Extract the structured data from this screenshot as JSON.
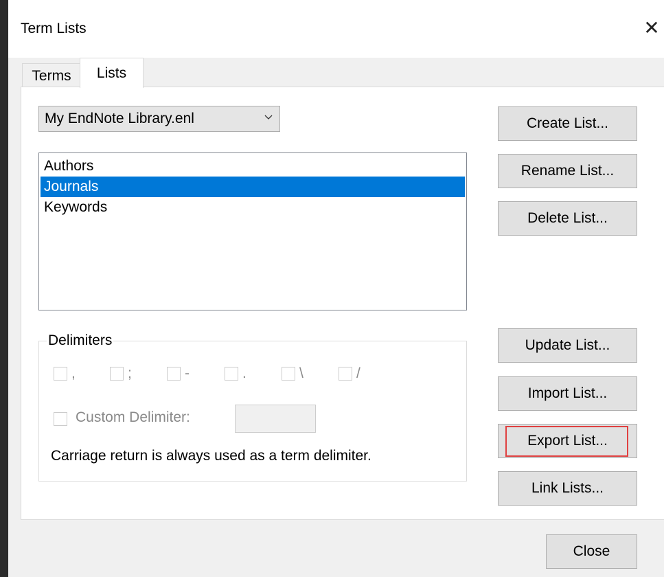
{
  "window": {
    "title": "Term Lists"
  },
  "tabs": [
    {
      "label": "Terms",
      "active": false
    },
    {
      "label": "Lists",
      "active": true
    }
  ],
  "library_select": {
    "value": "My EndNote Library.enl"
  },
  "lists": {
    "items": [
      "Authors",
      "Journals",
      "Keywords"
    ],
    "selected": "Journals"
  },
  "buttons": {
    "create": "Create List...",
    "rename": "Rename List...",
    "delete": "Delete List...",
    "update": "Update List...",
    "import": "Import List...",
    "export": "Export List...",
    "link": "Link Lists...",
    "close": "Close"
  },
  "delimiters": {
    "group_label": "Delimiters",
    "options": [
      ",",
      ";",
      "-",
      ".",
      "\\",
      "/"
    ],
    "custom_label": "Custom Delimiter:",
    "custom_value": "",
    "note": "Carriage return is always used as a term delimiter."
  },
  "colors": {
    "selection": "#0078d7",
    "highlight": "#e04040"
  }
}
